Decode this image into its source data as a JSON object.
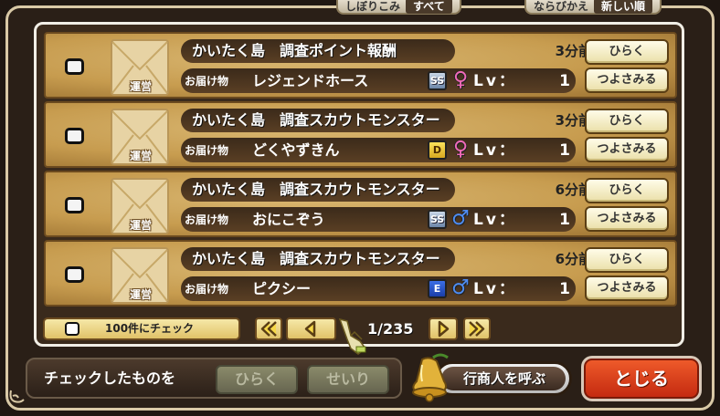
{
  "top_filters": {
    "filter_label": "しぼりこみ",
    "filter_value": "すべて",
    "sort_label": "ならびかえ",
    "sort_value": "新しい順"
  },
  "mail_rows": [
    {
      "sender": "運営",
      "title": "かいたく島　調査ポイント報酬",
      "time": "3分前",
      "item_label": "お届け物",
      "item_name": "レジェンドホース",
      "rank": "SS",
      "rank_class": "ss",
      "gender": "♀",
      "gender_class": "female",
      "lv_label": "Lv：",
      "lv_value": "1",
      "open_label": "ひらく",
      "strengthen_label": "つよさみる"
    },
    {
      "sender": "運営",
      "title": "かいたく島　調査スカウトモンスター",
      "time": "3分前",
      "item_label": "お届け物",
      "item_name": "どくやずきん",
      "rank": "D",
      "rank_class": "d",
      "gender": "♀",
      "gender_class": "female",
      "lv_label": "Lv：",
      "lv_value": "1",
      "open_label": "ひらく",
      "strengthen_label": "つよさみる"
    },
    {
      "sender": "運営",
      "title": "かいたく島　調査スカウトモンスター",
      "time": "6分前",
      "item_label": "お届け物",
      "item_name": "おにこぞう",
      "rank": "SS",
      "rank_class": "ss",
      "gender": "♂",
      "gender_class": "male",
      "lv_label": "Lv：",
      "lv_value": "1",
      "open_label": "ひらく",
      "strengthen_label": "つよさみる"
    },
    {
      "sender": "運営",
      "title": "かいたく島　調査スカウトモンスター",
      "time": "6分前",
      "item_label": "お届け物",
      "item_name": "ピクシー",
      "rank": "E",
      "rank_class": "e",
      "gender": "♂",
      "gender_class": "male",
      "lv_label": "Lv：",
      "lv_value": "1",
      "open_label": "ひらく",
      "strengthen_label": "つよさみる"
    }
  ],
  "pagination": {
    "check_100_label": "100件にチェック",
    "page_indicator": "1/235"
  },
  "footer": {
    "checked_label": "チェックしたものを",
    "open_button": "ひらく",
    "organize_button": "せいり",
    "merchant_button": "行商人を呼ぶ",
    "close_button": "とじる"
  }
}
